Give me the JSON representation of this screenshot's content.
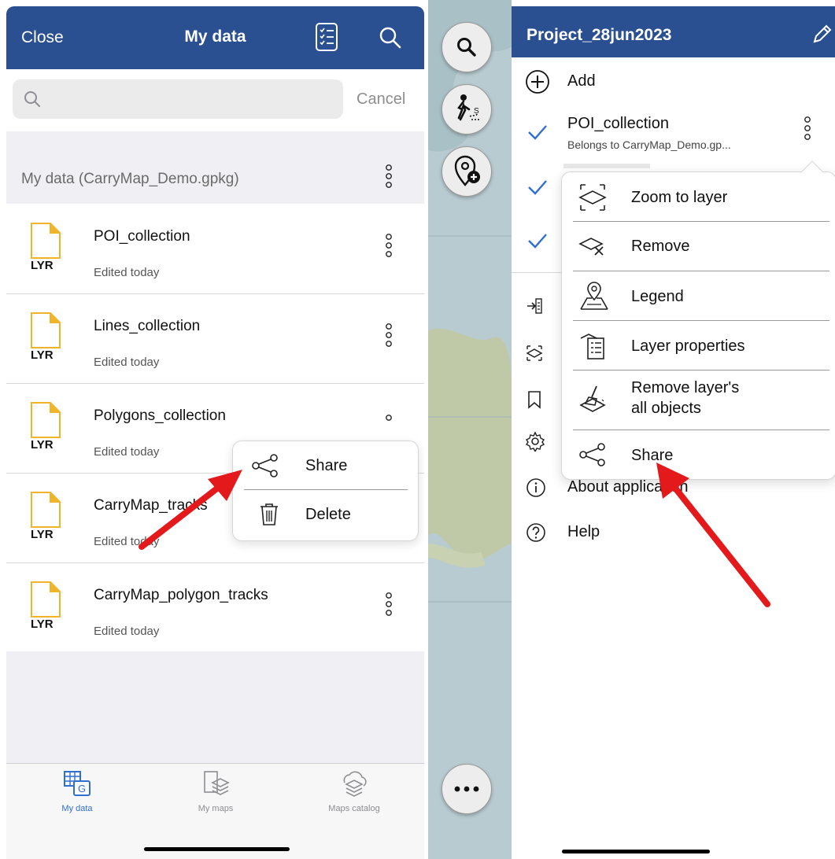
{
  "left_panel": {
    "header": {
      "close_label": "Close",
      "title": "My data",
      "list_icon": "checklist-icon",
      "search_icon": "search-icon"
    },
    "search": {
      "placeholder": "",
      "value": "",
      "cancel_label": "Cancel"
    },
    "group": {
      "title": "My data (CarryMap_Demo.gpkg)"
    },
    "files": [
      {
        "badge": "LYR",
        "name": "POI_collection",
        "subtitle": "Edited today"
      },
      {
        "badge": "LYR",
        "name": "Lines_collection",
        "subtitle": "Edited today"
      },
      {
        "badge": "LYR",
        "name": "Polygons_collection",
        "subtitle": "Edited today"
      },
      {
        "badge": "LYR",
        "name": "CarryMap_tracks",
        "subtitle": "Edited today"
      },
      {
        "badge": "LYR",
        "name": "CarryMap_polygon_tracks",
        "subtitle": "Edited today"
      }
    ],
    "context_menu": {
      "items": [
        {
          "label": "Share",
          "icon": "share-icon"
        },
        {
          "label": "Delete",
          "icon": "trash-icon"
        }
      ]
    },
    "tabbar": {
      "tabs": [
        {
          "label": "My data",
          "icon": "grid-data-icon",
          "active": true
        },
        {
          "label": "My maps",
          "icon": "layers-icon",
          "active": false
        },
        {
          "label": "Maps catalog",
          "icon": "cloud-layers-icon",
          "active": false
        }
      ],
      "active_color": "#2f6fd0",
      "inactive_color": "#8e8e93"
    }
  },
  "right_panel": {
    "map_buttons": [
      {
        "icon": "search-icon"
      },
      {
        "icon": "track-walker-icon"
      },
      {
        "icon": "add-location-icon"
      },
      {
        "icon": "more-icon"
      }
    ],
    "header": {
      "title": "Project_28jun2023",
      "edit_icon": "pencil-icon"
    },
    "add_label": "Add",
    "layers": [
      {
        "name": "POI_collection",
        "subtitle": "Belongs to CarryMap_Demo.gp...",
        "checked": true
      }
    ],
    "bottom_items": [
      {
        "label": "About application",
        "icon": "info-icon"
      },
      {
        "label": "Help",
        "icon": "help-icon"
      }
    ],
    "context_menu": {
      "items": [
        {
          "label": "Zoom to layer",
          "icon": "zoom-to-layer-icon"
        },
        {
          "label": "Remove",
          "icon": "remove-layer-icon"
        },
        {
          "label": "Legend",
          "icon": "legend-icon"
        },
        {
          "label": "Layer properties",
          "icon": "layer-properties-icon"
        },
        {
          "label": "Remove layer's all objects",
          "line1": "Remove layer's",
          "line2": "all objects",
          "icon": "broom-icon"
        },
        {
          "label": "Share",
          "icon": "share-icon"
        }
      ]
    }
  },
  "colors": {
    "header_blue": "#2a5091",
    "check_blue": "#2f6fd0",
    "file_icon_yellow": "#f0b429",
    "arrow_red": "#e3191c"
  }
}
